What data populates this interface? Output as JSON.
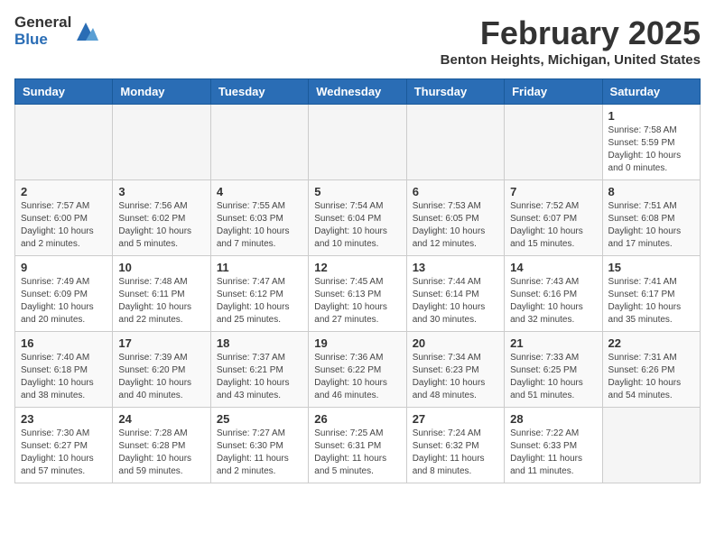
{
  "header": {
    "logo_general": "General",
    "logo_blue": "Blue",
    "month_title": "February 2025",
    "location": "Benton Heights, Michigan, United States"
  },
  "weekdays": [
    "Sunday",
    "Monday",
    "Tuesday",
    "Wednesday",
    "Thursday",
    "Friday",
    "Saturday"
  ],
  "weeks": [
    [
      {
        "day": "",
        "info": ""
      },
      {
        "day": "",
        "info": ""
      },
      {
        "day": "",
        "info": ""
      },
      {
        "day": "",
        "info": ""
      },
      {
        "day": "",
        "info": ""
      },
      {
        "day": "",
        "info": ""
      },
      {
        "day": "1",
        "info": "Sunrise: 7:58 AM\nSunset: 5:59 PM\nDaylight: 10 hours and 0 minutes."
      }
    ],
    [
      {
        "day": "2",
        "info": "Sunrise: 7:57 AM\nSunset: 6:00 PM\nDaylight: 10 hours and 2 minutes."
      },
      {
        "day": "3",
        "info": "Sunrise: 7:56 AM\nSunset: 6:02 PM\nDaylight: 10 hours and 5 minutes."
      },
      {
        "day": "4",
        "info": "Sunrise: 7:55 AM\nSunset: 6:03 PM\nDaylight: 10 hours and 7 minutes."
      },
      {
        "day": "5",
        "info": "Sunrise: 7:54 AM\nSunset: 6:04 PM\nDaylight: 10 hours and 10 minutes."
      },
      {
        "day": "6",
        "info": "Sunrise: 7:53 AM\nSunset: 6:05 PM\nDaylight: 10 hours and 12 minutes."
      },
      {
        "day": "7",
        "info": "Sunrise: 7:52 AM\nSunset: 6:07 PM\nDaylight: 10 hours and 15 minutes."
      },
      {
        "day": "8",
        "info": "Sunrise: 7:51 AM\nSunset: 6:08 PM\nDaylight: 10 hours and 17 minutes."
      }
    ],
    [
      {
        "day": "9",
        "info": "Sunrise: 7:49 AM\nSunset: 6:09 PM\nDaylight: 10 hours and 20 minutes."
      },
      {
        "day": "10",
        "info": "Sunrise: 7:48 AM\nSunset: 6:11 PM\nDaylight: 10 hours and 22 minutes."
      },
      {
        "day": "11",
        "info": "Sunrise: 7:47 AM\nSunset: 6:12 PM\nDaylight: 10 hours and 25 minutes."
      },
      {
        "day": "12",
        "info": "Sunrise: 7:45 AM\nSunset: 6:13 PM\nDaylight: 10 hours and 27 minutes."
      },
      {
        "day": "13",
        "info": "Sunrise: 7:44 AM\nSunset: 6:14 PM\nDaylight: 10 hours and 30 minutes."
      },
      {
        "day": "14",
        "info": "Sunrise: 7:43 AM\nSunset: 6:16 PM\nDaylight: 10 hours and 32 minutes."
      },
      {
        "day": "15",
        "info": "Sunrise: 7:41 AM\nSunset: 6:17 PM\nDaylight: 10 hours and 35 minutes."
      }
    ],
    [
      {
        "day": "16",
        "info": "Sunrise: 7:40 AM\nSunset: 6:18 PM\nDaylight: 10 hours and 38 minutes."
      },
      {
        "day": "17",
        "info": "Sunrise: 7:39 AM\nSunset: 6:20 PM\nDaylight: 10 hours and 40 minutes."
      },
      {
        "day": "18",
        "info": "Sunrise: 7:37 AM\nSunset: 6:21 PM\nDaylight: 10 hours and 43 minutes."
      },
      {
        "day": "19",
        "info": "Sunrise: 7:36 AM\nSunset: 6:22 PM\nDaylight: 10 hours and 46 minutes."
      },
      {
        "day": "20",
        "info": "Sunrise: 7:34 AM\nSunset: 6:23 PM\nDaylight: 10 hours and 48 minutes."
      },
      {
        "day": "21",
        "info": "Sunrise: 7:33 AM\nSunset: 6:25 PM\nDaylight: 10 hours and 51 minutes."
      },
      {
        "day": "22",
        "info": "Sunrise: 7:31 AM\nSunset: 6:26 PM\nDaylight: 10 hours and 54 minutes."
      }
    ],
    [
      {
        "day": "23",
        "info": "Sunrise: 7:30 AM\nSunset: 6:27 PM\nDaylight: 10 hours and 57 minutes."
      },
      {
        "day": "24",
        "info": "Sunrise: 7:28 AM\nSunset: 6:28 PM\nDaylight: 10 hours and 59 minutes."
      },
      {
        "day": "25",
        "info": "Sunrise: 7:27 AM\nSunset: 6:30 PM\nDaylight: 11 hours and 2 minutes."
      },
      {
        "day": "26",
        "info": "Sunrise: 7:25 AM\nSunset: 6:31 PM\nDaylight: 11 hours and 5 minutes."
      },
      {
        "day": "27",
        "info": "Sunrise: 7:24 AM\nSunset: 6:32 PM\nDaylight: 11 hours and 8 minutes."
      },
      {
        "day": "28",
        "info": "Sunrise: 7:22 AM\nSunset: 6:33 PM\nDaylight: 11 hours and 11 minutes."
      },
      {
        "day": "",
        "info": ""
      }
    ]
  ]
}
